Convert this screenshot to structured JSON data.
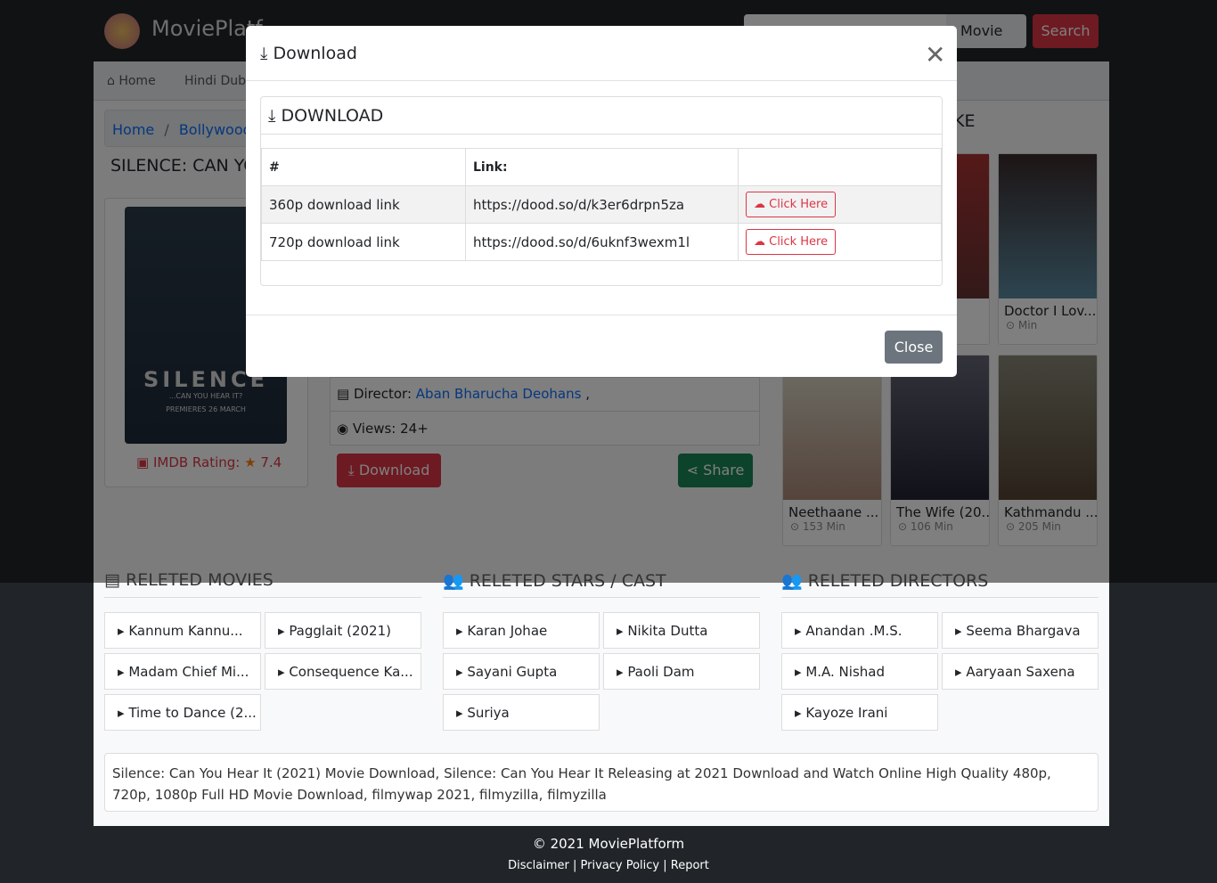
{
  "header": {
    "brand": "MoviePlatf",
    "search_select": "Movie",
    "search_button": "Search"
  },
  "nav": {
    "items": [
      "Home",
      "Hindi Dubb"
    ]
  },
  "breadcrumb": {
    "home": "Home",
    "sep": "/",
    "category": "Bollywood M"
  },
  "movie": {
    "title": "SILENCE: CAN YO",
    "poster_text": "SILENCE",
    "poster_sub": "...CAN YOU HEAR IT?",
    "poster_date": "PREMIERES 26 MARCH",
    "imdb_label": "IMDB Rating:",
    "imdb_value": "7.4",
    "director_label": "Director:",
    "director": "Aban Bharucha Deohans",
    "director_sep": ",",
    "views": "Views: 24+",
    "download": "Download",
    "share": "Share"
  },
  "side": {
    "heading": "KE",
    "cards": [
      {
        "title": "",
        "meta": ""
      },
      {
        "title": "aa...",
        "meta": ""
      },
      {
        "title": "Doctor I Lov...",
        "meta": "Min"
      },
      {
        "title": "Neethaane ...",
        "meta": "153 Min"
      },
      {
        "title": "The Wife  (20...",
        "meta": "106 Min"
      },
      {
        "title": "Kathmandu ...",
        "meta": "205 Min"
      }
    ]
  },
  "modal": {
    "title": "Download",
    "card_title": "DOWNLOAD",
    "close_button": "Close",
    "columns": [
      "#",
      "Link:",
      ""
    ],
    "rows": [
      {
        "quality": "360p download link",
        "link": "https://dood.so/d/k3er6drpn5za",
        "action": "Click Here"
      },
      {
        "quality": "720p download link",
        "link": "https://dood.so/d/6uknf3wexm1l",
        "action": "Click Here"
      }
    ]
  },
  "related_movies": {
    "heading": "RELETED MOVIES",
    "items": [
      "Kannum Kannu...",
      "Pagglait (2021)",
      "Madam Chief Mi...",
      "Consequence Ka...",
      "Time to Dance (2..."
    ]
  },
  "related_cast": {
    "heading": "RELETED STARS / CAST",
    "items": [
      "Karan Johae",
      "Nikita Dutta",
      "Sayani Gupta",
      "Paoli Dam",
      "Suriya"
    ]
  },
  "related_directors": {
    "heading": "RELETED DIRECTORS",
    "items": [
      "Anandan .M.S.",
      "Seema Bhargava",
      "M.A. Nishad",
      "Aaryaan Saxena",
      "Kayoze Irani"
    ]
  },
  "description": "Silence: Can You Hear It (2021) Movie Download, Silence: Can You Hear It Releasing at 2021 Download and Watch Online High Quality 480p, 720p, 1080p Full HD Movie Download, filmywap 2021, filmyzilla, filmyzilla",
  "footer": {
    "copyright": "© 2021 MoviePlatform",
    "links": [
      "Disclaimer",
      "Privacy Policy",
      "Report"
    ],
    "sep": " | "
  }
}
